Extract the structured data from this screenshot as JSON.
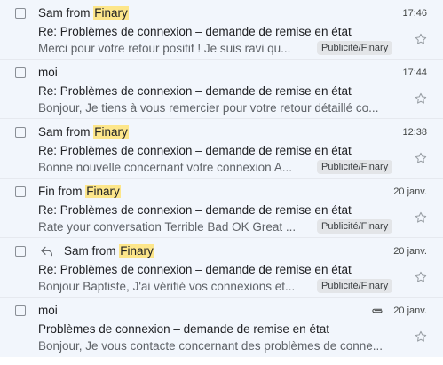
{
  "emails": [
    {
      "sender_prefix": "Sam from ",
      "sender_highlight": "Finary",
      "time": "17:46",
      "subject": "Re: Problèmes de connexion – demande de remise en état",
      "snippet": "Merci pour votre retour positif ! Je suis ravi qu...",
      "label": "Publicité/Finary",
      "reply": false,
      "attachment": false
    },
    {
      "sender_prefix": "moi",
      "sender_highlight": "",
      "time": "17:44",
      "subject": "Re: Problèmes de connexion – demande de remise en état",
      "snippet": "Bonjour, Je tiens à vous remercier pour votre retour détaillé co...",
      "label": "",
      "reply": false,
      "attachment": false
    },
    {
      "sender_prefix": "Sam from ",
      "sender_highlight": "Finary",
      "time": "12:38",
      "subject": "Re: Problèmes de connexion – demande de remise en état",
      "snippet": "Bonne nouvelle concernant votre connexion A...",
      "label": "Publicité/Finary",
      "reply": false,
      "attachment": false
    },
    {
      "sender_prefix": "Fin from ",
      "sender_highlight": "Finary",
      "time": "20 janv.",
      "subject": "Re: Problèmes de connexion – demande de remise en état",
      "snippet": "Rate your conversation Terrible Bad OK Great ...",
      "label": "Publicité/Finary",
      "reply": false,
      "attachment": false
    },
    {
      "sender_prefix": "Sam from ",
      "sender_highlight": "Finary",
      "time": "20 janv.",
      "subject": "Re: Problèmes de connexion – demande de remise en état",
      "snippet": "Bonjour Baptiste, J'ai vérifié vos connexions et...",
      "label": "Publicité/Finary",
      "reply": true,
      "attachment": false
    },
    {
      "sender_prefix": "moi",
      "sender_highlight": "",
      "time": "20 janv.",
      "subject": "Problèmes de connexion – demande de remise en état",
      "snippet": "Bonjour, Je vous contacte concernant des problèmes de conne...",
      "label": "",
      "reply": false,
      "attachment": true
    }
  ],
  "colors": {
    "row_background": "#f2f6fc",
    "highlight": "#fde68a",
    "label_background": "#e3e5e8"
  },
  "icons": {
    "checkbox": "checkbox-icon",
    "star": "star-icon",
    "reply": "reply-icon",
    "attachment": "paperclip-icon"
  }
}
